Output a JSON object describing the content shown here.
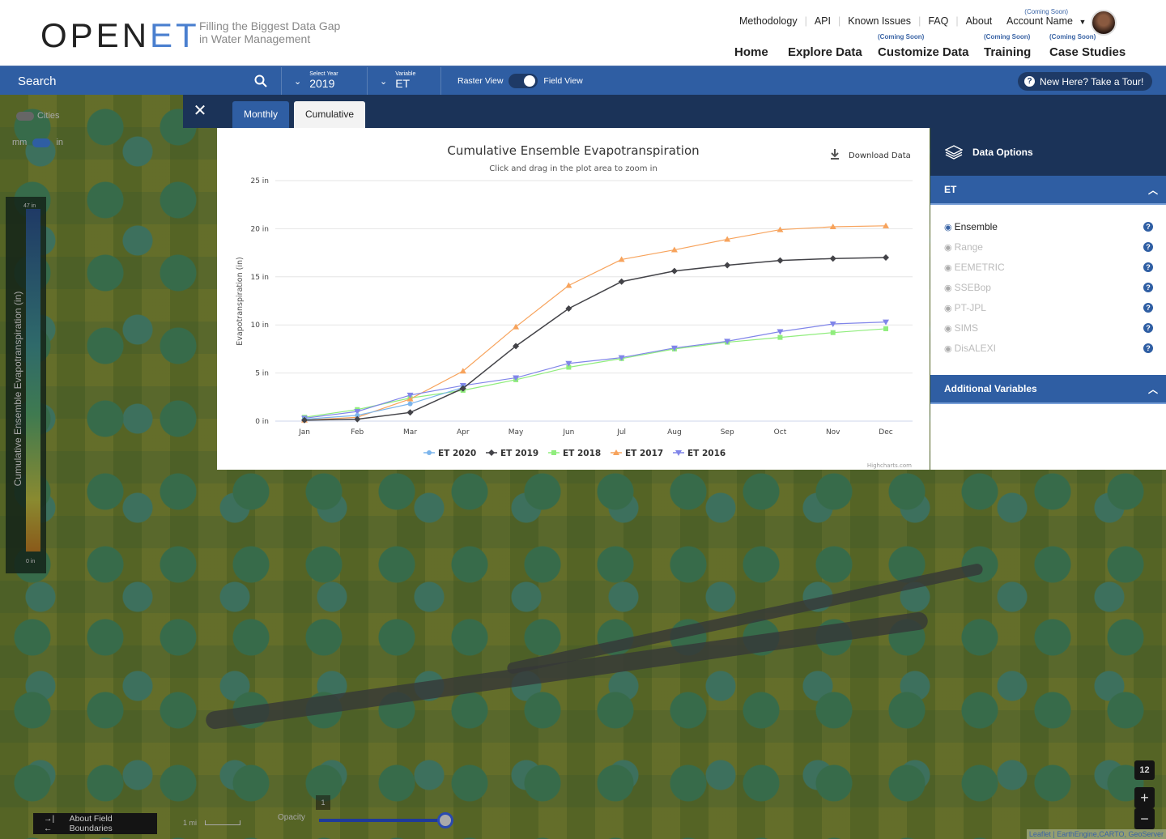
{
  "header": {
    "logo_text": "OPEN",
    "logo_accent": "ET",
    "tagline_line1": "Filling the Biggest Data Gap",
    "tagline_line2": "in Water Management",
    "top_links": [
      "Methodology",
      "API",
      "Known Issues",
      "FAQ",
      "About"
    ],
    "account": {
      "soon": "(Coming Soon)",
      "name": "Account Name"
    },
    "nav": [
      {
        "label": "Home",
        "soon": ""
      },
      {
        "label": "Explore Data",
        "soon": ""
      },
      {
        "label": "Customize Data",
        "soon": "(Coming Soon)"
      },
      {
        "label": "Training",
        "soon": "(Coming Soon)"
      },
      {
        "label": "Case Studies",
        "soon": "(Coming Soon)"
      }
    ]
  },
  "toolbar": {
    "search": "Search",
    "year_label": "Select Year",
    "year": "2019",
    "variable_label": "Variable",
    "variable": "ET",
    "raster": "Raster View",
    "field": "Field View",
    "tour": "New Here? Take a Tour!"
  },
  "tabs": {
    "close": "✕",
    "monthly": "Monthly",
    "cumulative": "Cumulative",
    "active": "Cumulative"
  },
  "map": {
    "cities": "Cities",
    "unit_mm": "mm",
    "unit_in": "in",
    "legend_title": "Cumulative Ensemble Evapotranspiration (in)",
    "legend_max": "47 in",
    "legend_min": "0 in",
    "field_boundaries": "About Field Boundaries",
    "scale": "1 mi",
    "opacity": "Opacity",
    "opacity_value": "1",
    "zoom_level": "12",
    "zoom_in": "+",
    "zoom_out": "−",
    "attribution": "Leaflet | EarthEngine,CARTO, GeoServer"
  },
  "side": {
    "title": "Data Options",
    "et_section": "ET",
    "options": [
      {
        "label": "Ensemble",
        "on": true
      },
      {
        "label": "Range",
        "on": false
      },
      {
        "label": "EEMETRIC",
        "on": false
      },
      {
        "label": "SSEBop",
        "on": false
      },
      {
        "label": "PT-JPL",
        "on": false
      },
      {
        "label": "SIMS",
        "on": false
      },
      {
        "label": "DisALEXI",
        "on": false
      }
    ],
    "additional": "Additional Variables"
  },
  "chart": {
    "download": "Download Data",
    "credit": "Highcharts.com"
  },
  "chart_data": {
    "type": "line",
    "title": "Cumulative Ensemble Evapotranspiration",
    "subtitle": "Click and drag in the plot area to zoom in",
    "ylabel": "Evapotranspiration (in)",
    "xlabel": "",
    "categories": [
      "Jan",
      "Feb",
      "Mar",
      "Apr",
      "May",
      "Jun",
      "Jul",
      "Aug",
      "Sep",
      "Oct",
      "Nov",
      "Dec"
    ],
    "yticks": [
      "0 in",
      "5 in",
      "10 in",
      "15 in",
      "20 in",
      "25 in"
    ],
    "ylim": [
      0,
      25
    ],
    "grid": true,
    "legend": "bottom",
    "series": [
      {
        "name": "ET 2020",
        "color": "#7cb5ec",
        "marker": "circle",
        "values": [
          0.2,
          0.6,
          1.8,
          3.5,
          null,
          null,
          null,
          null,
          null,
          null,
          null,
          null
        ]
      },
      {
        "name": "ET 2019",
        "color": "#434348",
        "marker": "diamond",
        "values": [
          0.1,
          0.2,
          0.9,
          3.4,
          7.8,
          11.7,
          14.5,
          15.6,
          16.2,
          16.7,
          16.9,
          17.0
        ]
      },
      {
        "name": "ET 2018",
        "color": "#90ed7d",
        "marker": "square",
        "values": [
          0.4,
          1.2,
          2.4,
          3.2,
          4.3,
          5.6,
          6.5,
          7.5,
          8.2,
          8.7,
          9.2,
          9.6
        ]
      },
      {
        "name": "ET 2017",
        "color": "#f7a35c",
        "marker": "triangle",
        "values": [
          0.1,
          0.4,
          2.3,
          5.2,
          9.8,
          14.1,
          16.8,
          17.8,
          18.9,
          19.9,
          20.2,
          20.3
        ]
      },
      {
        "name": "ET 2016",
        "color": "#8085e9",
        "marker": "triangle-down",
        "values": [
          0.3,
          1.0,
          2.7,
          3.7,
          4.5,
          6.0,
          6.6,
          7.6,
          8.3,
          9.3,
          10.1,
          10.3
        ]
      }
    ]
  }
}
